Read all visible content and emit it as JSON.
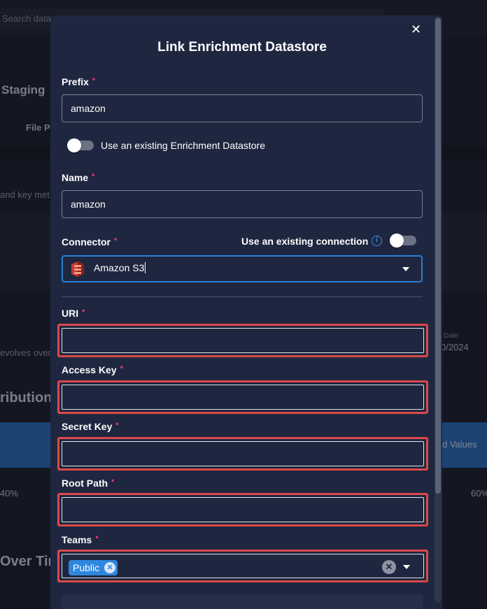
{
  "background": {
    "search_placeholder": "Search data",
    "staging": "Staging",
    "file_tab": "File P",
    "key_metrics_text": "and key met",
    "evolves_text": "evolves over",
    "date_label": "Date",
    "date_value": "0/2024",
    "distribution_title": "ribution",
    "values_label": "d Values",
    "pct_left": "40%",
    "pct_right": "60%",
    "over_time_title": "Over Tim"
  },
  "modal": {
    "title": "Link Enrichment Datastore",
    "close_icon": "close-icon",
    "prefix": {
      "label": "Prefix",
      "value": "amazon"
    },
    "use_existing_datastore": {
      "label": "Use an existing Enrichment Datastore",
      "enabled": false
    },
    "name": {
      "label": "Name",
      "value": "amazon"
    },
    "connector": {
      "label": "Connector",
      "use_existing_connection_label": "Use an existing connection",
      "use_existing_connection_enabled": false,
      "selected": "Amazon S3",
      "icon": "amazon-s3-icon"
    },
    "uri": {
      "label": "URI",
      "value": ""
    },
    "access_key": {
      "label": "Access Key",
      "value": ""
    },
    "secret_key": {
      "label": "Secret Key",
      "value": ""
    },
    "root_path": {
      "label": "Root Path",
      "value": ""
    },
    "teams": {
      "label": "Teams",
      "chips": [
        "Public"
      ]
    },
    "required_marker": "•",
    "highlight_color": "#d94a4a",
    "accent_color": "#2f86de"
  }
}
